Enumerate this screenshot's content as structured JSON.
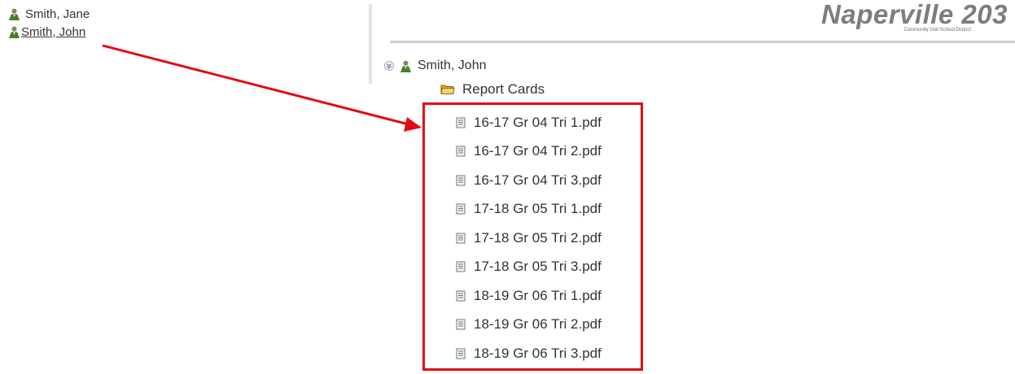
{
  "students": [
    {
      "name": "Smith, Jane",
      "icon": "person-icon"
    },
    {
      "name": "Smith, John",
      "icon": "person-icon"
    }
  ],
  "logo": {
    "main": "Naperville 203",
    "sub": "Community Unit School District"
  },
  "tree": {
    "student": "Smith, John",
    "folder": "Report Cards",
    "files": [
      "16-17 Gr 04 Tri 1.pdf",
      "16-17 Gr 04 Tri 2.pdf",
      "16-17 Gr 04 Tri 3.pdf",
      "17-18 Gr 05 Tri 1.pdf",
      "17-18 Gr 05 Tri 2.pdf",
      "17-18 Gr 05 Tri 3.pdf",
      "18-19 Gr 06 Tri 1.pdf",
      "18-19 Gr 06 Tri 2.pdf",
      "18-19 Gr 06 Tri 3.pdf"
    ]
  },
  "colors": {
    "highlight": "#e30b12",
    "person_icon": "#4a7d2c",
    "folder_icon": "#e0b430",
    "logo_text": "#7b7d80",
    "logo_accent": "#6aa33a"
  }
}
